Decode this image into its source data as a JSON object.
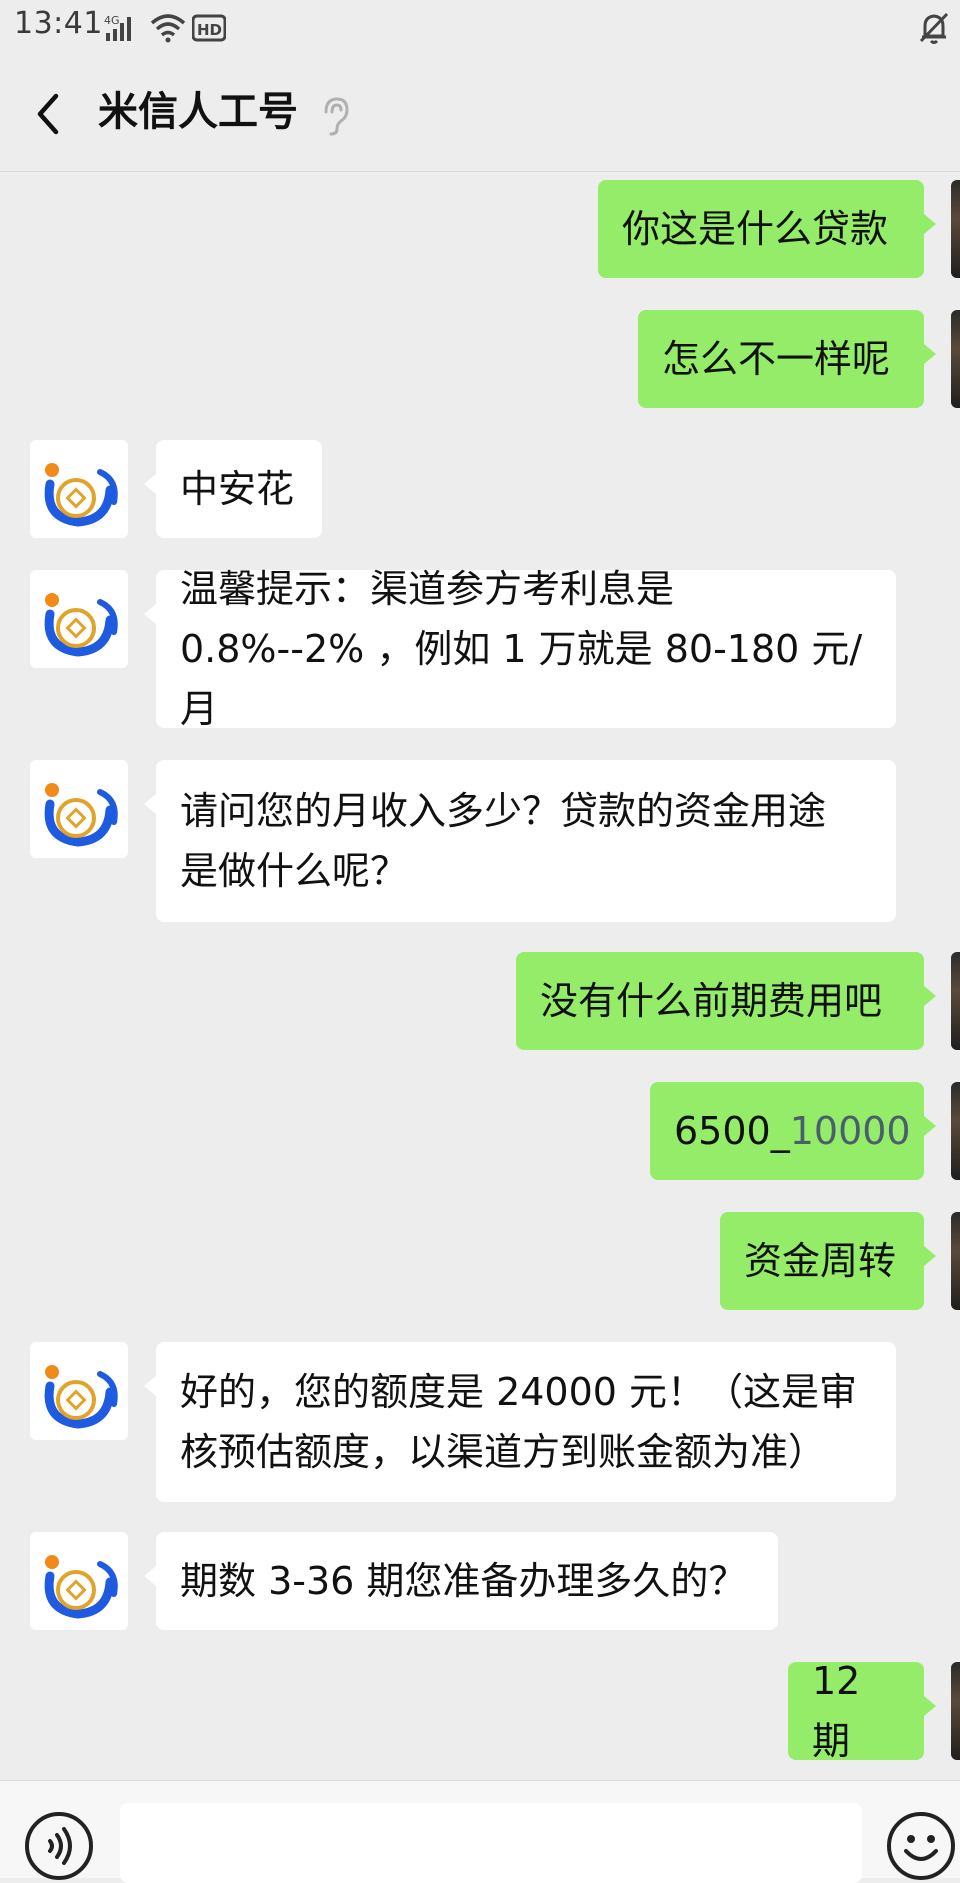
{
  "status_bar": {
    "time": "13:41",
    "network": "4G"
  },
  "header": {
    "title": "米信人工号"
  },
  "messages": [
    {
      "side": "right",
      "lines": [
        "你这是什么贷款"
      ]
    },
    {
      "side": "right",
      "lines": [
        "怎么不一样呢"
      ]
    },
    {
      "side": "left",
      "lines": [
        "中安花"
      ]
    },
    {
      "side": "left",
      "lines": [
        "温馨提示：渠道参方考利息是",
        "0.8%--2% ，例如 1 万就是 80-180 元/月"
      ]
    },
    {
      "side": "left",
      "lines": [
        "请问您的月收入多少？贷款的资金用途",
        "是做什么呢？"
      ]
    },
    {
      "side": "right",
      "lines": [
        "没有什么前期费用吧"
      ]
    },
    {
      "side": "right",
      "lines": [
        "6500_",
        "10000"
      ]
    },
    {
      "side": "right",
      "lines": [
        "资金周转"
      ]
    },
    {
      "side": "left",
      "lines": [
        "好的，您的额度是 24000 元！（这是审",
        "核预估额度，以渠道方到账金额为准）"
      ]
    },
    {
      "side": "left",
      "lines": [
        "期数 3-36 期您准备办理多久的？"
      ]
    },
    {
      "side": "right",
      "lines": [
        "12 期"
      ]
    }
  ],
  "input": {
    "value": ""
  },
  "colors": {
    "bubble_self": "#95ec69",
    "bubble_other": "#ffffff",
    "background": "#ededed",
    "logo_blue": "#1f5be0",
    "logo_gold": "#e2a32a"
  }
}
